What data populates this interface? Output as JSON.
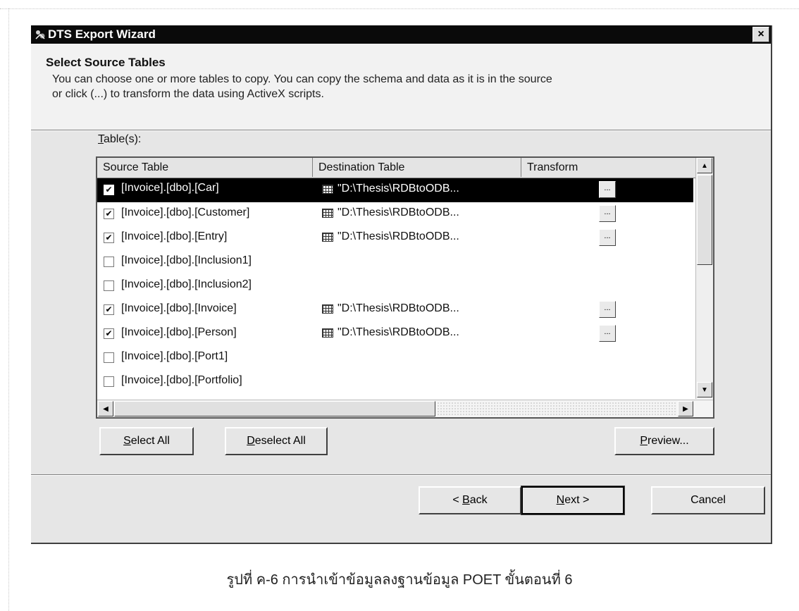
{
  "window": {
    "title": "DTS Export Wizard",
    "close_glyph": "×"
  },
  "header": {
    "title": "Select Source Tables",
    "description_line1": "You can choose one or more tables to copy.  You can copy the schema and data as it is in the source",
    "description_line2": "or click (...) to transform the data using ActiveX scripts."
  },
  "tables": {
    "label_prefix": "T",
    "label_rest": "able(s):",
    "columns": {
      "source": "Source Table",
      "destination": "Destination Table",
      "transform": "Transform"
    },
    "transform_btn_label": "...",
    "rows": [
      {
        "source": "[Invoice].[dbo].[Car]",
        "checked": true,
        "destination": "\"D:\\Thesis\\RDBtoODB...",
        "selected": true
      },
      {
        "source": "[Invoice].[dbo].[Customer]",
        "checked": true,
        "destination": "\"D:\\Thesis\\RDBtoODB..."
      },
      {
        "source": "[Invoice].[dbo].[Entry]",
        "checked": true,
        "destination": "\"D:\\Thesis\\RDBtoODB..."
      },
      {
        "source": "[Invoice].[dbo].[Inclusion1]",
        "checked": false,
        "destination": ""
      },
      {
        "source": "[Invoice].[dbo].[Inclusion2]",
        "checked": false,
        "destination": ""
      },
      {
        "source": "[Invoice].[dbo].[Invoice]",
        "checked": true,
        "destination": "\"D:\\Thesis\\RDBtoODB..."
      },
      {
        "source": "[Invoice].[dbo].[Person]",
        "checked": true,
        "destination": "\"D:\\Thesis\\RDBtoODB..."
      },
      {
        "source": "[Invoice].[dbo].[Port1]",
        "checked": false,
        "destination": ""
      },
      {
        "source": "[Invoice].[dbo].[Portfolio]",
        "checked": false,
        "destination": ""
      }
    ]
  },
  "buttons": {
    "select_all": {
      "mnemonic": "S",
      "rest": "elect All"
    },
    "deselect_all": {
      "mnemonic": "D",
      "rest": "eselect All"
    },
    "preview": {
      "mnemonic": "P",
      "rest": "review..."
    },
    "back": {
      "prefix": "< ",
      "mnemonic": "B",
      "rest": "ack"
    },
    "next": {
      "mnemonic": "N",
      "rest": "ext >"
    },
    "cancel": "Cancel"
  },
  "caption": "รูปที่ ค-6 การนำเข้าข้อมูลลงฐานข้อมูล POET ขั้นตอนที่ 6"
}
